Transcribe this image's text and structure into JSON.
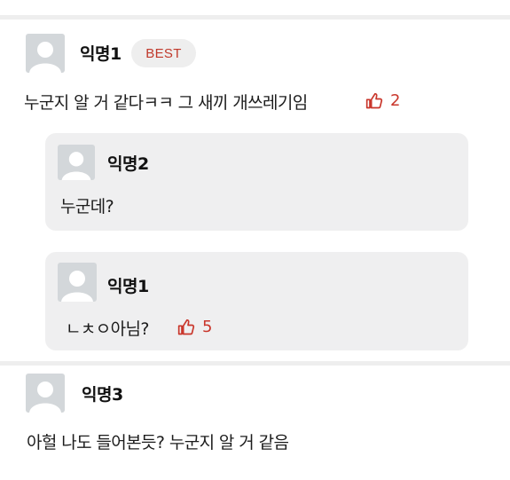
{
  "theme": {
    "accent": "#c9362b",
    "avatar_bg": "#d3d7da",
    "reply_bg": "#efeff0"
  },
  "comments": [
    {
      "author": "익명1",
      "badge": "BEST",
      "text": "누군지 알 거 같다ㅋㅋ 그 새끼 개쓰레기임",
      "likes": "2",
      "replies": [
        {
          "author": "익명2",
          "text": "누군데?"
        },
        {
          "author": "익명1",
          "text": "ㄴㅊㅇ아님?",
          "likes": "5"
        }
      ]
    },
    {
      "author": "익명3",
      "text": "아헐 나도 들어본듯? 누군지 알 거 같음"
    }
  ]
}
